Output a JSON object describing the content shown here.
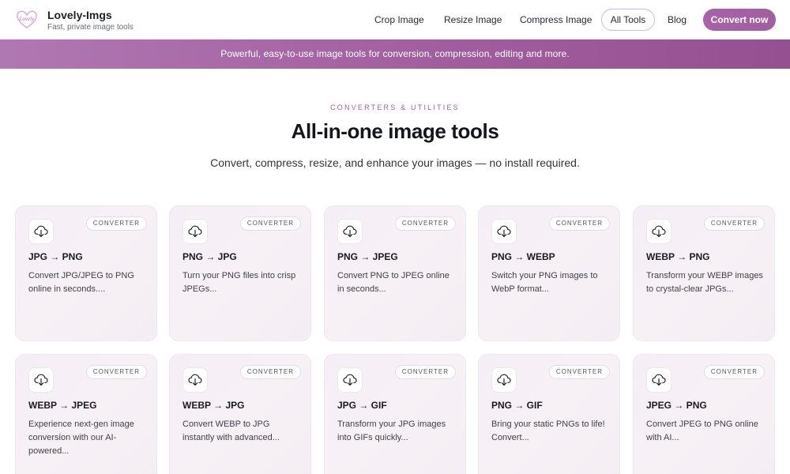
{
  "header": {
    "brand": "Lovely-Imgs",
    "tagline": "Fast, private image tools",
    "logo_text": "Lovely",
    "nav": [
      {
        "label": "Crop Image"
      },
      {
        "label": "Resize Image"
      },
      {
        "label": "Compress Image"
      },
      {
        "label": "All Tools"
      },
      {
        "label": "Blog"
      }
    ],
    "cta": "Convert now"
  },
  "banner": "Powerful, easy-to-use image tools for conversion, compression, editing and more.",
  "hero": {
    "eyebrow": "CONVERTERS & UTILITIES",
    "title": "All-in-one image tools",
    "subtitle": "Convert, compress, resize, and enhance your images — no install required."
  },
  "cards": [
    {
      "badge": "CONVERTER",
      "title": "JPG → PNG",
      "desc": "Convert JPG/JPEG to PNG online in seconds...."
    },
    {
      "badge": "CONVERTER",
      "title": "PNG → JPG",
      "desc": "Turn your PNG files into crisp JPEGs..."
    },
    {
      "badge": "CONVERTER",
      "title": "PNG → JPEG",
      "desc": "Convert PNG to JPEG online in seconds..."
    },
    {
      "badge": "CONVERTER",
      "title": "PNG → WEBP",
      "desc": "Switch your PNG images to WebP format..."
    },
    {
      "badge": "CONVERTER",
      "title": "WEBP → PNG",
      "desc": "Transform your WEBP images to crystal-clear JPGs..."
    },
    {
      "badge": "CONVERTER",
      "title": "WEBP → JPEG",
      "desc": "Experience next-gen image conversion with our AI-powered..."
    },
    {
      "badge": "CONVERTER",
      "title": "WEBP → JPG",
      "desc": "Convert WEBP to JPG instantly with advanced..."
    },
    {
      "badge": "CONVERTER",
      "title": "JPG → GIF",
      "desc": "Transform your JPG images into GIFs quickly..."
    },
    {
      "badge": "CONVERTER",
      "title": "PNG → GIF",
      "desc": "Bring your static PNGs to life! Convert..."
    },
    {
      "badge": "CONVERTER",
      "title": "JPEG → PNG",
      "desc": "Convert JPEG to PNG online with AI..."
    }
  ],
  "icons": {
    "logo": "heart-logo-icon",
    "card_icon": "cloud-download-icon"
  },
  "colors": {
    "accent": "#a05f9f",
    "banner": "#a05c9d",
    "pill_border": "#b7c3e8",
    "card_bg": "#f6eef6"
  }
}
